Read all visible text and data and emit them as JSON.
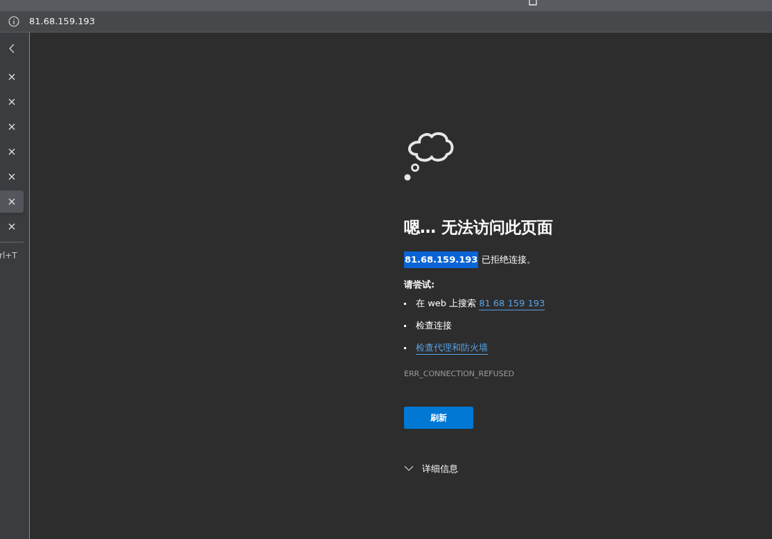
{
  "address_bar": {
    "url": "81.68.159.193"
  },
  "sidebar": {
    "tabs": [
      {
        "selected": false
      },
      {
        "selected": false
      },
      {
        "selected": false
      },
      {
        "selected": false
      },
      {
        "selected": false
      },
      {
        "selected": true
      },
      {
        "selected": false
      }
    ],
    "new_tab_hint": "rl+T"
  },
  "error": {
    "title": "嗯… 无法访问此页面",
    "host": "81.68.159.193",
    "host_selected": true,
    "message": "已拒绝连接。",
    "try_heading": "请尝试:",
    "suggestions": [
      {
        "text": "在 web 上搜索",
        "link": "81 68 159 193"
      },
      {
        "text": "检查连接"
      },
      {
        "link": "检查代理和防火墙"
      }
    ],
    "code": "ERR_CONNECTION_REFUSED",
    "refresh_button": "刷新",
    "details": {
      "label": "详细信息",
      "expanded": false
    }
  }
}
